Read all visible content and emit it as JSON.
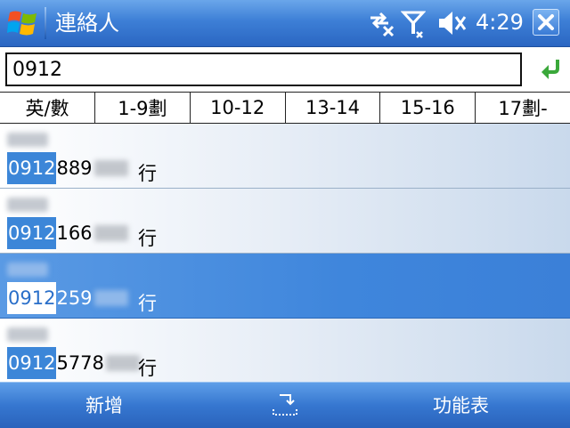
{
  "titlebar": {
    "app_title": "連絡人",
    "time": "4:29"
  },
  "icons": {
    "start": "windows-flag-icon",
    "connectivity": "data-connection-off-icon",
    "signal": "antenna-no-signal-icon",
    "volume": "speaker-muted-icon",
    "close": "close-x-icon",
    "go": "green-enter-arrow-icon",
    "input_panel": "keyboard-input-panel-icon"
  },
  "search": {
    "value": "0912"
  },
  "tabs": [
    "英/數",
    "1-9劃",
    "10-12",
    "13-14",
    "15-16",
    "17劃-"
  ],
  "contacts": [
    {
      "match": "0912",
      "number_visible": "889",
      "type": "行",
      "selected": false
    },
    {
      "match": "0912",
      "number_visible": "166",
      "type": "行",
      "selected": false
    },
    {
      "match": "0912",
      "number_visible": "259",
      "type": "行",
      "selected": true
    },
    {
      "match": "0912",
      "number_visible": "5778",
      "type": "行",
      "selected": false
    }
  ],
  "softkeys": {
    "left": "新增",
    "right": "功能表"
  },
  "colors": {
    "titlebar": "#3d7fd6",
    "highlight": "#3c86d8",
    "selected_row": "#3f86dc",
    "go_arrow": "#3aa83a"
  }
}
